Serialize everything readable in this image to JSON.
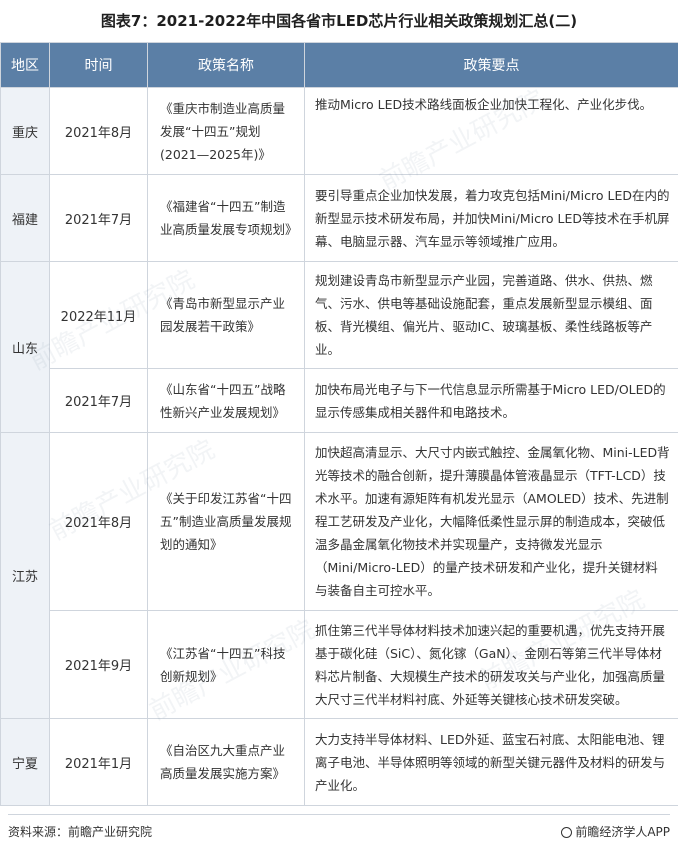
{
  "title": "图表7：2021-2022年中国各省市LED芯片行业相关政策规划汇总(二)",
  "table": {
    "headers": [
      "地区",
      "时间",
      "政策名称",
      "政策要点"
    ],
    "rows": [
      {
        "region": "重庆",
        "date": "2021年8月",
        "name": "《重庆市制造业高质量发展“十四五”规划(2021—2025年)》",
        "points": "推动Micro LED技术路线面板企业加快工程化、产业化步伐。"
      },
      {
        "region": "福建",
        "date": "2021年7月",
        "name": "《福建省“十四五”制造业高质量发展专项规划》",
        "points": "要引导重点企业加快发展，着力攻克包括Mini/Micro LED在内的新型显示技术研发布局，并加快Mini/Micro LED等技术在手机屏幕、电脑显示器、汽车显示等领域推广应用。"
      },
      {
        "region": "山东",
        "date": "2022年11月",
        "name": "《青岛市新型显示产业园发展若干政策》",
        "points": "规划建设青岛市新型显示产业园，完善道路、供水、供热、燃气、污水、供电等基础设施配套，重点发展新型显示模组、面板、背光模组、偏光片、驱动IC、玻璃基板、柔性线路板等产业。"
      },
      {
        "region": "",
        "date": "2021年7月",
        "name": "《山东省“十四五”战略性新兴产业发展规划》",
        "points": "加快布局光电子与下一代信息显示所需基于Micro LED/OLED的显示传感集成相关器件和电路技术。"
      },
      {
        "region": "江苏",
        "date": "2021年8月",
        "name": "《关于印发江苏省“十四五”制造业高质量发展规划的通知》",
        "points": "加快超高清显示、大尺寸内嵌式触控、金属氧化物、Mini-LED背光等技术的融合创新，提升薄膜晶体管液晶显示（TFT-LCD）技术水平。加速有源矩阵有机发光显示（AMOLED）技术、先进制程工艺研发及产业化，大幅降低柔性显示屏的制造成本，突破低温多晶金属氧化物技术并实现量产，支持微发光显示（Mini/Micro-LED）的量产技术研发和产业化，提升关键材料与装备自主可控水平。"
      },
      {
        "region": "",
        "date": "2021年9月",
        "name": "《江苏省“十四五”科技创新规划》",
        "points": "抓住第三代半导体材料技术加速兴起的重要机遇，优先支持开展基于碳化硅（SiC）、氮化镓（GaN）、金刚石等第三代半导体材料芯片制备、大规模生产技术的研发攻关与产业化，加强高质量大尺寸三代半材料衬底、外延等关键核心技术研发突破。"
      },
      {
        "region": "宁夏",
        "date": "2021年1月",
        "name": "《自治区九大重点产业高质量发展实施方案》",
        "points": "大力支持半导体材料、LED外延、蓝宝石衬底、太阳能电池、锂离子电池、半导体照明等领域的新型关键元器件及材料的研发与产业化。"
      }
    ]
  },
  "footer": {
    "source": "资料来源：前瞻产业研究院",
    "brand": "前瞻经济学人APP",
    "brand_icon": "brand-logo-icon"
  },
  "watermark": "前瞻产业研究院"
}
